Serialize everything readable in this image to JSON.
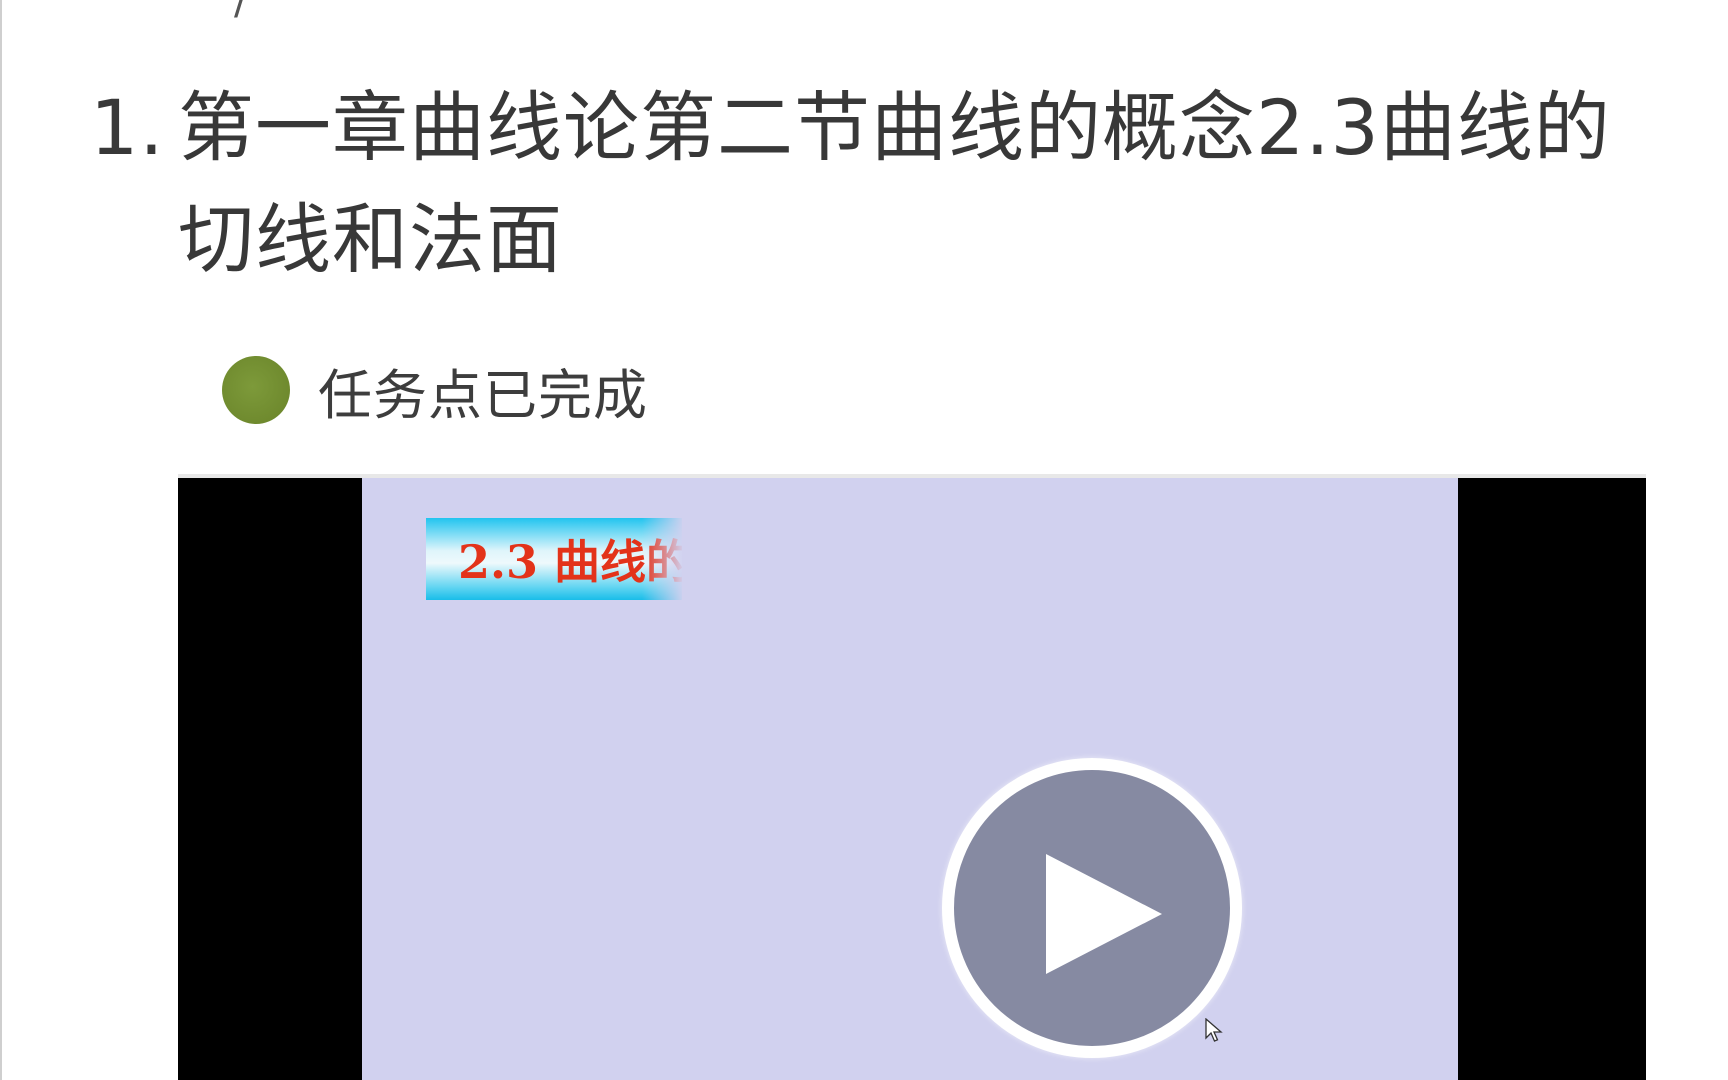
{
  "top_fragment": "/",
  "section": {
    "number": "1.",
    "title": "第一章曲线论第二节曲线的概念2.3曲线的切线和法面"
  },
  "task_status": {
    "label": "任务点已完成",
    "color": "#6f8a2e"
  },
  "video": {
    "slide_title": "2.3  曲线的",
    "frame_color": "#d1d1ef",
    "title_color": "#e3331a",
    "play_icon": "play-icon"
  }
}
